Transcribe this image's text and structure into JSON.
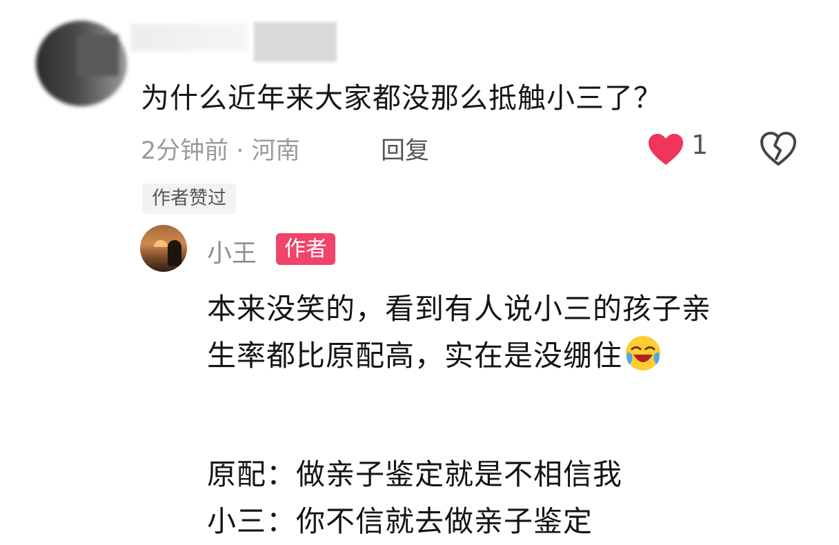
{
  "comment": {
    "text": "为什么近年来大家都没那么抵触小三了？",
    "time_location": "2分钟前 · 河南",
    "reply_label": "回复",
    "like_count": "1",
    "author_liked_tag": "作者赞过"
  },
  "reply": {
    "username": "小王",
    "badge": "作者",
    "lines": [
      "本来没笑的，看到有人说小三的孩子亲",
      "生率都比原配高，实在是没绷住",
      "原配：做亲子鉴定就是不相信我",
      "小三：你不信就去做亲子鉴定"
    ],
    "emoji_icon": "laughing-crying-emoji"
  },
  "colors": {
    "like_heart": "#f0355a",
    "author_badge": "#f0446b",
    "meta_text": "#9a9a9a"
  }
}
